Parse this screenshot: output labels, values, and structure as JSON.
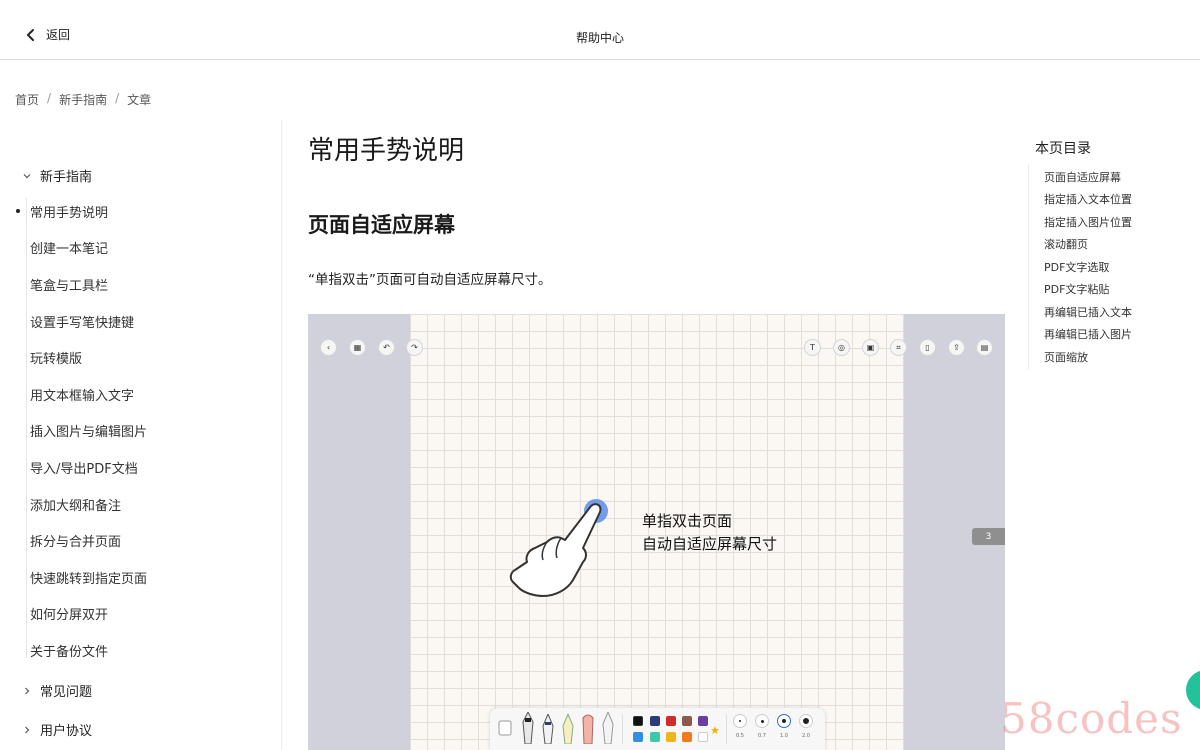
{
  "topbar": {
    "back_label": "返回",
    "title": "帮助中心"
  },
  "breadcrumb": [
    "首页",
    "新手指南",
    "文章"
  ],
  "breadcrumb_sep": "/",
  "sidebar": {
    "groups": [
      {
        "label": "新手指南",
        "expanded": true
      },
      {
        "label": "常见问题",
        "expanded": false
      },
      {
        "label": "用户协议",
        "expanded": false
      }
    ],
    "items": [
      "常用手势说明",
      "创建一本笔记",
      "笔盒与工具栏",
      "设置手写笔快捷键",
      "玩转模版",
      "用文本框输入文字",
      "插入图片与编辑图片",
      "导入/导出PDF文档",
      "添加大纲和备注",
      "拆分与合并页面",
      "快速跳转到指定页面",
      "如何分屏双开",
      "关于备份文件"
    ],
    "active_item": "常用手势说明"
  },
  "article": {
    "title": "常用手势说明",
    "section_title": "页面自适应屏幕",
    "paragraph": "“单指双击”页面可自动自适应屏幕尺寸。"
  },
  "figure": {
    "gesture_line1": "单指双击页面",
    "gesture_line2": "自动自适应屏幕尺寸",
    "page_number": "3",
    "pen_sizes": [
      "0.5",
      "0.7",
      "1.0",
      "2.0"
    ],
    "colors_row1": [
      "#111111",
      "#2f3a7a",
      "#d12b2b",
      "#8a5b4a",
      "#6a3fa0"
    ],
    "colors_row2": [
      "#2f8fe0",
      "#3cc9a8",
      "#f2b416",
      "#f07b1c",
      "#ffffff"
    ]
  },
  "toc": {
    "title": "本页目录",
    "items": [
      "页面自适应屏幕",
      "指定插入文本位置",
      "指定插入图片位置",
      "滚动翻页",
      "PDF文字选取",
      "PDF文字粘贴",
      "再编辑已插入文本",
      "再编辑已插入图片",
      "页面缩放"
    ]
  },
  "watermark": "58codes"
}
